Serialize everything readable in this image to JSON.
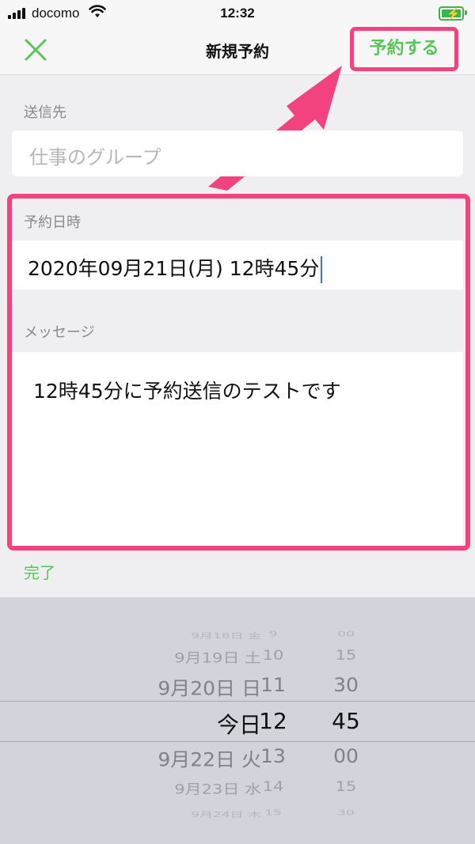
{
  "status_bar": {
    "carrier": "docomo",
    "time": "12:32",
    "battery_color": "#3bb54a"
  },
  "nav": {
    "close_icon": "close-x-icon",
    "title": "新規予約",
    "reserve_label": "予約する"
  },
  "recipient": {
    "label": "送信先",
    "value": "仕事のグループ"
  },
  "datetime": {
    "label": "予約日時",
    "value": "2020年09月21日(月) 12時45分"
  },
  "message": {
    "label": "メッセージ",
    "value": "12時45分に予約送信のテストです"
  },
  "done_label": "完了",
  "picker": {
    "rows": [
      {
        "date": "9月18日 金",
        "hour": "9",
        "minute": "00"
      },
      {
        "date": "9月19日 土",
        "hour": "10",
        "minute": "15"
      },
      {
        "date": "9月20日 日",
        "hour": "11",
        "minute": "30"
      },
      {
        "date": "今日",
        "hour": "12",
        "minute": "45"
      },
      {
        "date": "9月22日 火",
        "hour": "13",
        "minute": "00"
      },
      {
        "date": "9月23日 水",
        "hour": "14",
        "minute": "15"
      },
      {
        "date": "9月24日 木",
        "hour": "15",
        "minute": "30"
      }
    ],
    "selected_index": 3
  },
  "colors": {
    "accent_green": "#5ac35a",
    "highlight_pink": "#f2437e",
    "caret_blue": "#3a6fd8"
  }
}
